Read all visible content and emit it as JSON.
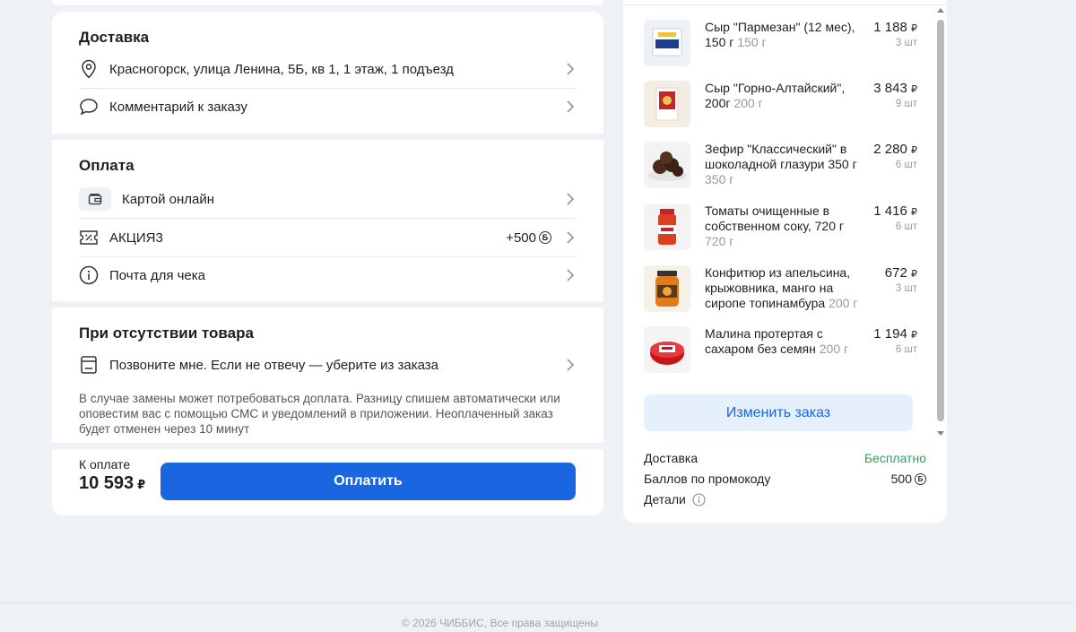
{
  "delivery": {
    "title": "Доставка",
    "address": "Красногорск, улица Ленина, 5Б, кв 1, 1 этаж, 1 подъезд",
    "comment": "Комментарий к заказу"
  },
  "payment": {
    "title": "Оплата",
    "method": "Картой онлайн",
    "promo": "АКЦИЯ3",
    "promo_bonus": "+500",
    "bonus_symbol": "Б",
    "receipt_email": "Почта для чека"
  },
  "out_of_stock": {
    "title": "При отсутствии товара",
    "option": "Позвоните мне. Если не отвечу — уберите из заказа",
    "note": "В случае замены может потребоваться доплата. Разницу спишем автоматически или оповестим вас с помощью СМС и уведомлений в приложении. Неоплаченный заказ будет отменен через 10 минут"
  },
  "checkout": {
    "to_pay_label": "К оплате",
    "total": "10 593",
    "currency": "₽",
    "pay_button": "Оплатить"
  },
  "order_items": [
    {
      "name": "Сыр \"Пармезан\" (12 мес), 150 г",
      "weight": "150 г",
      "price": "1 188",
      "qty": "3 шт"
    },
    {
      "name": "Сыр \"Горно-Алтайский\", 200г",
      "weight": "200 г",
      "price": "3 843",
      "qty": "9 шт"
    },
    {
      "name": "Зефир \"Классический\" в шоколадной глазури 350 г",
      "weight": "350 г",
      "price": "2 280",
      "qty": "6 шт"
    },
    {
      "name": "Томаты очищенные в собственном соку, 720 г",
      "weight": "720 г",
      "price": "1 416",
      "qty": "6 шт"
    },
    {
      "name": "Конфитюр из апельсина, крыжовника, манго на сиропе топинамбура",
      "weight": "200 г",
      "price": "672",
      "qty": "3 шт"
    },
    {
      "name": "Малина протертая с сахаром без семян",
      "weight": "200 г",
      "price": "1 194",
      "qty": "6 шт"
    }
  ],
  "order_summary": {
    "edit_button": "Изменить заказ",
    "delivery_label": "Доставка",
    "delivery_value": "Бесплатно",
    "promo_points_label": "Баллов по промокоду",
    "promo_points_value": "500",
    "details_label": "Детали"
  },
  "footer": {
    "copyright": "© 2026 ЧИББИС, Все права защищены"
  },
  "colors": {
    "accent": "#1a66e0",
    "accent_light": "#e5f0fc",
    "success": "#2aa35a",
    "background": "#eef2f6"
  }
}
